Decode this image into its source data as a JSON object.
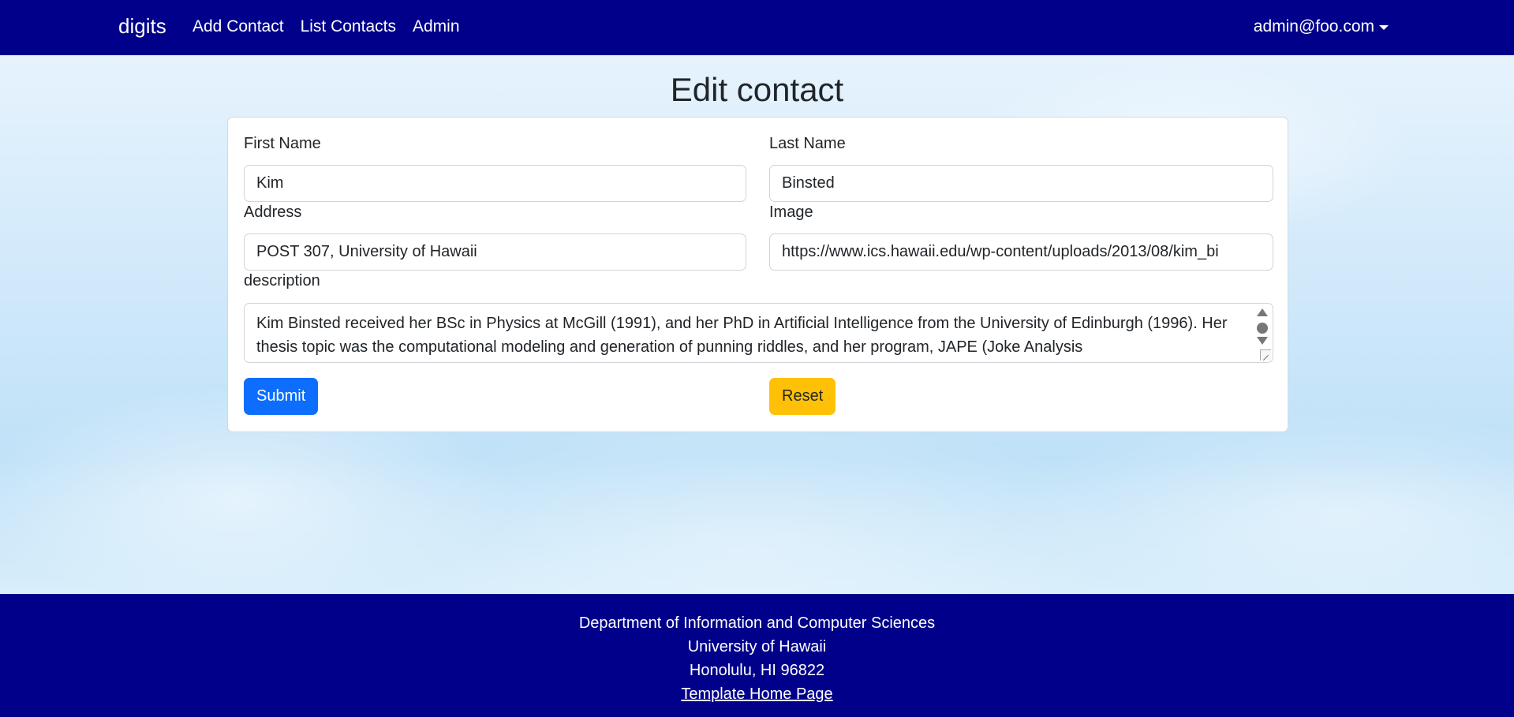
{
  "navbar": {
    "brand": "digits",
    "links": [
      {
        "label": "Add Contact"
      },
      {
        "label": "List Contacts"
      },
      {
        "label": "Admin"
      }
    ],
    "user": "admin@foo.com",
    "background": "#00008b"
  },
  "page": {
    "title": "Edit contact"
  },
  "form": {
    "first_name": {
      "label": "First Name",
      "value": "Kim"
    },
    "last_name": {
      "label": "Last Name",
      "value": "Binsted"
    },
    "address": {
      "label": "Address",
      "value": "POST 307, University of Hawaii"
    },
    "image": {
      "label": "Image",
      "value": "https://www.ics.hawaii.edu/wp-content/uploads/2013/08/kim_bi"
    },
    "description": {
      "label": "description",
      "value": "Kim Binsted received her BSc in Physics at McGill (1991), and her PhD in Artificial Intelligence from the University of Edinburgh (1996). Her thesis topic was the computational modeling and generation of punning riddles, and her program, JAPE (Joke Analysis"
    },
    "submit_label": "Submit",
    "reset_label": "Reset",
    "submit_color": "#0d6efd",
    "reset_color": "#ffc107"
  },
  "footer": {
    "line1": "Department of Information and Computer Sciences",
    "line2": "University of Hawaii",
    "line3": "Honolulu, HI 96822",
    "link": "Template Home Page"
  }
}
